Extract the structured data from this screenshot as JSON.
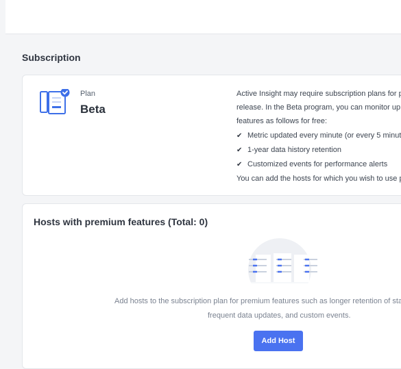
{
  "section": {
    "title": "Subscription"
  },
  "plan": {
    "icon": "plan-document-check-icon",
    "label": "Plan",
    "name": "Beta",
    "description_lines": [
      "Active Insight may require subscription plans for p",
      "release. In the Beta program, you can monitor up t",
      "features as follows for free:"
    ],
    "features": [
      "Metric updated every minute (or every 5 minut",
      "1-year data history retention",
      "Customized events for performance alerts"
    ],
    "feature_icon": "checkmark-icon",
    "footer_line": "You can add the hosts for which you wish to use p"
  },
  "hosts": {
    "title": "Hosts with premium features (Total: 0)",
    "empty_icon": "hosts-empty-state-icon",
    "empty_text_line1": "Add hosts to the subscription plan for premium features such as longer retention of sta",
    "empty_text_line2": "frequent data updates, and custom events.",
    "add_button_label": "Add Host"
  },
  "colors": {
    "accent": "#4a72f0",
    "background": "#f4f5f7",
    "card": "#ffffff",
    "border": "#e3e6ea"
  }
}
